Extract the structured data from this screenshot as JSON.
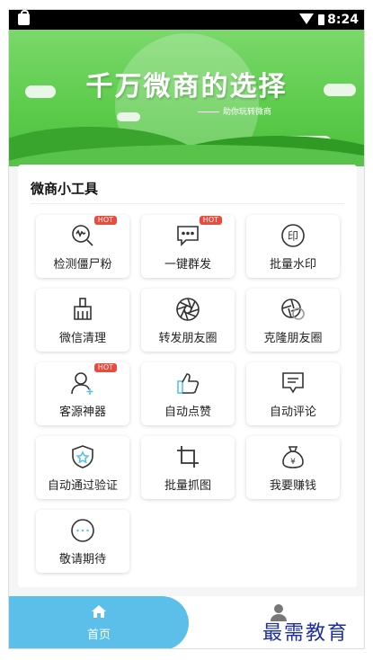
{
  "status_bar": {
    "time": "8:24"
  },
  "banner": {
    "title": "千万微商的选择",
    "subtitle": "助你玩转微商"
  },
  "section": {
    "title": "微商小工具"
  },
  "tools": [
    {
      "label": "检测僵尸粉",
      "badge": "HOT",
      "icon": "search-wave-icon"
    },
    {
      "label": "一键群发",
      "badge": "HOT",
      "icon": "chat-bubble-icon"
    },
    {
      "label": "批量水印",
      "badge": "",
      "icon": "stamp-icon"
    },
    {
      "label": "微信清理",
      "badge": "",
      "icon": "broom-icon"
    },
    {
      "label": "转发朋友圈",
      "badge": "",
      "icon": "aperture-icon"
    },
    {
      "label": "克隆朋友圈",
      "badge": "",
      "icon": "aperture-clone-icon"
    },
    {
      "label": "客源神器",
      "badge": "HOT",
      "icon": "add-user-icon"
    },
    {
      "label": "自动点赞",
      "badge": "",
      "icon": "thumbs-up-icon"
    },
    {
      "label": "自动评论",
      "badge": "",
      "icon": "comment-icon"
    },
    {
      "label": "自动通过验证",
      "badge": "",
      "icon": "shield-star-icon"
    },
    {
      "label": "批量抓图",
      "badge": "",
      "icon": "crop-icon"
    },
    {
      "label": "我要赚钱",
      "badge": "",
      "icon": "money-bag-icon"
    },
    {
      "label": "敬请期待",
      "badge": "",
      "icon": "more-icon"
    }
  ],
  "bottom_nav": {
    "home_label": "首页"
  },
  "watermark": "最需教育",
  "colors": {
    "accent": "#5bbfe9",
    "banner_green": "#5ccb4b",
    "hot": "#e74c3c",
    "icon_stroke": "#333333"
  }
}
